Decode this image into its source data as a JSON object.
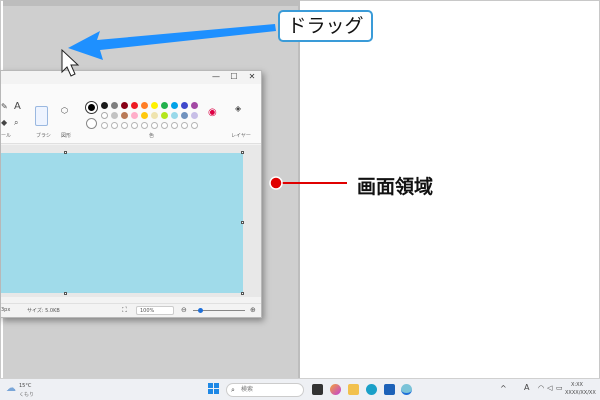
{
  "callouts": {
    "drag_label": "ドラッグ",
    "area_label": "画面領域"
  },
  "paint": {
    "window_controls": [
      "—",
      "☐",
      "✕"
    ],
    "ribbon_labels": {
      "tools": "ール",
      "brush": "ブラシ",
      "shapes": "図形",
      "colors": "色",
      "layers": "レイヤー"
    },
    "status": {
      "position": "3px",
      "size": "サイズ: 5.0KB",
      "zoom": "100%"
    },
    "palette_row1": [
      "#1a1a1a",
      "#7f7f7f",
      "#880015",
      "#ed1c24",
      "#ff7f27",
      "#fff200",
      "#22b14c",
      "#00a2e8",
      "#3f48cc",
      "#a349a4"
    ],
    "palette_row2": [
      "#ffffff",
      "#c3c3c3",
      "#b97a57",
      "#ffaec9",
      "#ffc90e",
      "#efe4b0",
      "#b5e61d",
      "#99d9ea",
      "#7092be",
      "#c8bfe7"
    ],
    "canvas_color": "#a0dbea"
  },
  "taskbar": {
    "weather_temp": "15°C",
    "weather_desc": "くもり",
    "search_placeholder": "検索",
    "clock_time": "X:XX",
    "clock_date": "XXXX/XX/XX",
    "lang_indicator": "A"
  },
  "colors": {
    "arrow_blue": "#1e90ff",
    "pointer_red": "#e00000",
    "callout_border": "#3a9bd8"
  }
}
